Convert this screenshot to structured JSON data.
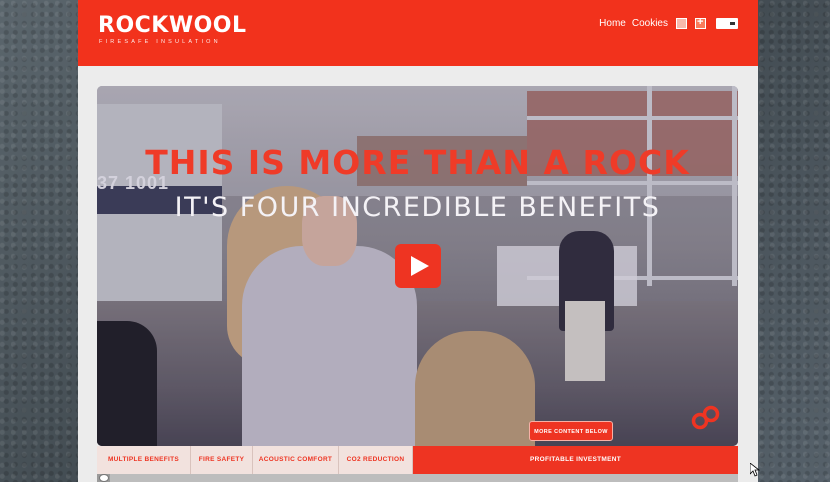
{
  "brand": {
    "logo": "ROCKWOOL",
    "tagline": "FIRESAFE INSULATION",
    "accent_color": "#ee3422"
  },
  "topnav": {
    "home": "Home",
    "cookies": "Cookies",
    "icons": [
      "bookmark-icon",
      "plus-icon",
      "language-select"
    ]
  },
  "hero": {
    "building_number": "37 1001",
    "headline": "THIS IS MORE THAN A ROCK",
    "subline": "IT'S FOUR INCREDIBLE BENEFITS",
    "play_icon": "play-icon",
    "more_button": "MORE CONTENT BELOW",
    "link_icon": "link-chain-icon"
  },
  "tabs": [
    {
      "label": "MULTIPLE BENEFITS",
      "active": false
    },
    {
      "label": "FIRE SAFETY",
      "active": false
    },
    {
      "label": "ACOUSTIC COMFORT",
      "active": false
    },
    {
      "label": "CO2 REDUCTION",
      "active": false
    },
    {
      "label": "PROFITABLE INVESTMENT",
      "active": true
    }
  ],
  "video_progress": 0.02
}
